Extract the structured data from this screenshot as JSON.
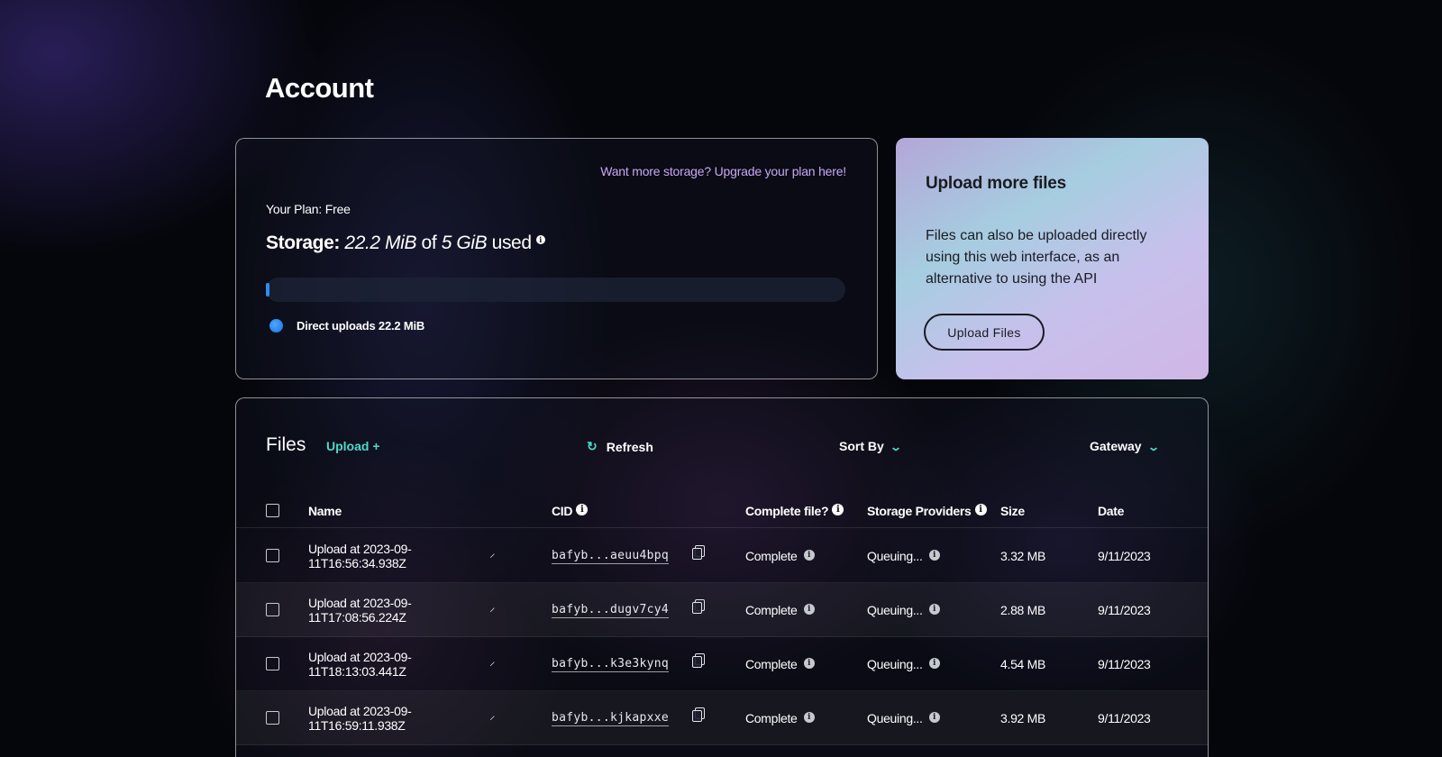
{
  "page": {
    "title": "Account"
  },
  "storage": {
    "upgrade_link": "Want more storage? Upgrade your plan here!",
    "plan": "Your Plan: Free",
    "label": "Storage:",
    "used": "22.2 MiB",
    "of_text": "of",
    "total": "5 GiB",
    "used_text": "used",
    "info": "i",
    "used_fraction": 0.0043,
    "legend_label": "Direct uploads",
    "legend_value": "22.2 MiB",
    "bar_color": "#2d8cf0"
  },
  "upload_card": {
    "title": "Upload more files",
    "description": "Files can also be uploaded directly using this web interface, as an alternative to using the API",
    "button": "Upload Files"
  },
  "files": {
    "title": "Files",
    "upload_link": "Upload +",
    "refresh": "Refresh",
    "sort_by": "Sort By",
    "gateway": "Gateway",
    "columns": {
      "name": "Name",
      "cid": "CID",
      "complete": "Complete file?",
      "providers": "Storage Providers",
      "size": "Size",
      "date": "Date"
    },
    "rows": [
      {
        "name": "Upload at 2023-09-11T16:56:34.938Z",
        "cid": "bafyb...aeuu4bpq",
        "complete": "Complete",
        "providers": "Queuing...",
        "size": "3.32 MB",
        "date": "9/11/2023"
      },
      {
        "name": "Upload at 2023-09-11T17:08:56.224Z",
        "cid": "bafyb...dugv7cy4",
        "complete": "Complete",
        "providers": "Queuing...",
        "size": "2.88 MB",
        "date": "9/11/2023"
      },
      {
        "name": "Upload at 2023-09-11T18:13:03.441Z",
        "cid": "bafyb...k3e3kynq",
        "complete": "Complete",
        "providers": "Queuing...",
        "size": "4.54 MB",
        "date": "9/11/2023"
      },
      {
        "name": "Upload at 2023-09-11T16:59:11.938Z",
        "cid": "bafyb...kjkapxxe",
        "complete": "Complete",
        "providers": "Queuing...",
        "size": "3.92 MB",
        "date": "9/11/2023"
      }
    ]
  },
  "colors": {
    "accent": "#4fd8c6",
    "link": "#c9a8f5",
    "upload_card_bg": "#b8c8e6"
  }
}
